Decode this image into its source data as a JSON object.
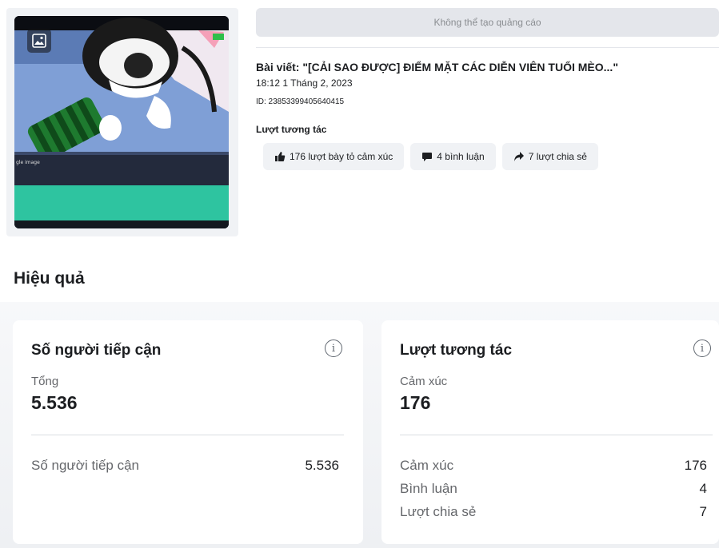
{
  "thumbnail": {
    "caption": "gle image"
  },
  "banner": {
    "text": "Không thể tạo quảng cáo"
  },
  "post": {
    "title": "Bài viết: \"[CẢI SAO ĐƯỢC] ĐIỂM MẶT CÁC DIỄN VIÊN TUỔI MÈO...\"",
    "time": "18:12 1 Tháng 2, 2023",
    "id": "ID: 23853399405640415",
    "interaction_label": "Lượt tương tác",
    "chips": [
      {
        "icon": "thumbs-up-icon",
        "label": "176 lượt bày tỏ cảm xúc"
      },
      {
        "icon": "comment-icon",
        "label": "4 bình luận"
      },
      {
        "icon": "share-icon",
        "label": "7 lượt chia sẻ"
      }
    ]
  },
  "performance": {
    "heading": "Hiệu quả",
    "reach_card": {
      "title": "Số người tiếp cận",
      "sub_label": "Tổng",
      "big_value": "5.536",
      "rows": [
        {
          "label": "Số người tiếp cận",
          "value": "5.536"
        }
      ]
    },
    "engagement_card": {
      "title": "Lượt tương tác",
      "sub_label": "Cảm xúc",
      "big_value": "176",
      "rows": [
        {
          "label": "Cảm xúc",
          "value": "176"
        },
        {
          "label": "Bình luận",
          "value": "4"
        },
        {
          "label": "Lượt chia sẻ",
          "value": "7"
        }
      ]
    },
    "info_icon": "info-icon"
  }
}
